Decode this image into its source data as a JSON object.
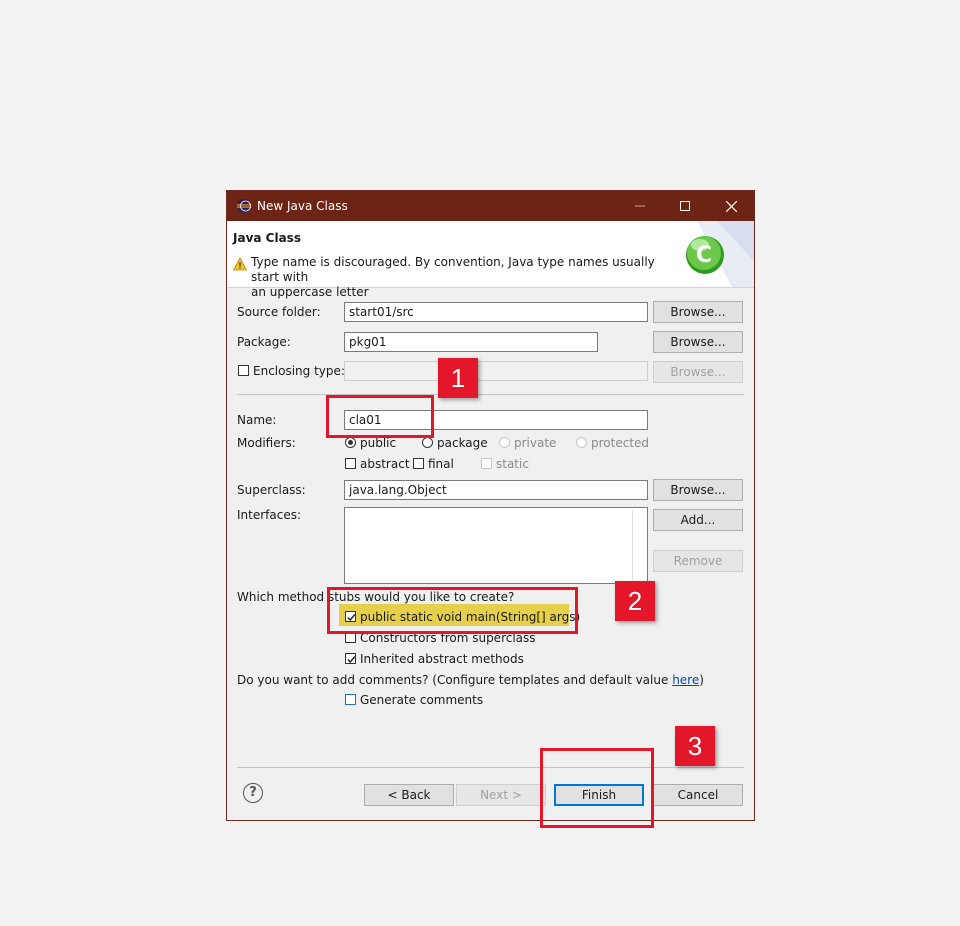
{
  "window": {
    "title": "New Java Class",
    "minimize_icon": "minimize-icon",
    "maximize_icon": "maximize-icon",
    "close_icon": "close-icon",
    "title_bar_color": "#6e2414"
  },
  "banner": {
    "heading": "Java Class",
    "warning_line1": "Type name is discouraged. By convention, Java type names usually start with",
    "warning_line2": "an uppercase letter",
    "warning_icon": "warning-icon",
    "wizard_icon": "java-class-wizard-icon"
  },
  "form": {
    "source_folder_label": "Source folder:",
    "source_folder_value": "start01/src",
    "package_label": "Package:",
    "package_value": "pkg01",
    "enclosing_type_label": "Enclosing type:",
    "enclosing_type_value": "",
    "browse_label": "Browse...",
    "name_label": "Name:",
    "name_value": "cla01",
    "modifiers_label": "Modifiers:",
    "mod_public": "public",
    "mod_package": "package",
    "mod_private": "private",
    "mod_protected": "protected",
    "mod_abstract": "abstract",
    "mod_final": "final",
    "mod_static": "static",
    "superclass_label": "Superclass:",
    "superclass_value": "java.lang.Object",
    "interfaces_label": "Interfaces:",
    "add_label": "Add...",
    "remove_label": "Remove",
    "stubs_question": "Which method stubs would you like to create?",
    "stub_main": "public static void main(String[] args)",
    "stub_constructors": "Constructors from superclass",
    "stub_inherited": "Inherited abstract methods",
    "comments_question_prefix": "Do you want to add comments? (Configure templates and default value ",
    "comments_link": "here",
    "comments_question_suffix": ")",
    "generate_comments": "Generate comments"
  },
  "footer": {
    "help_icon": "help-icon",
    "help_glyph": "?",
    "back_label": "< Back",
    "next_label": "Next >",
    "finish_label": "Finish",
    "cancel_label": "Cancel"
  },
  "annotations": {
    "badge1": "1",
    "badge2": "2",
    "badge3": "3",
    "color": "#e3162a"
  }
}
